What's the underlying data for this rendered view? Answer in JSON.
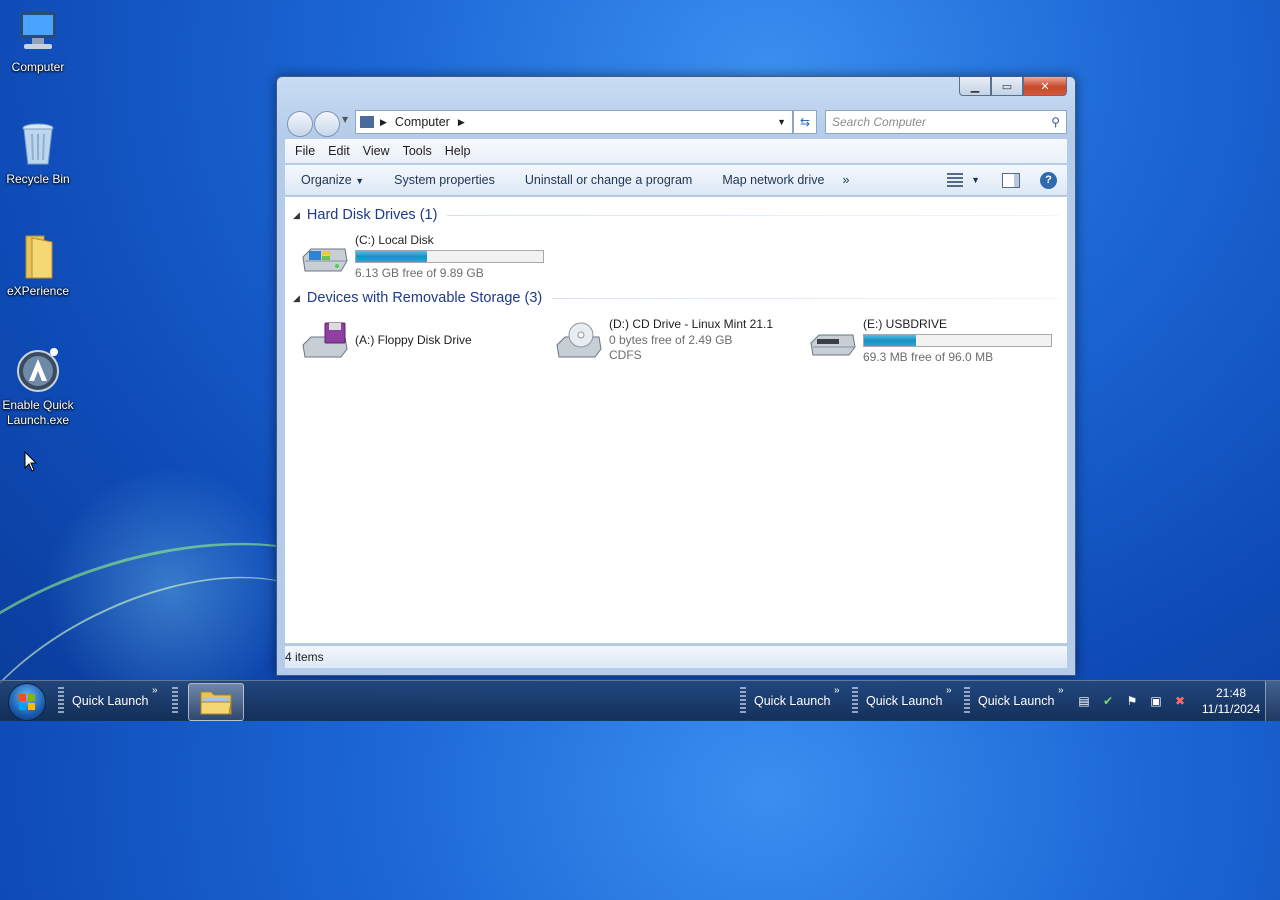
{
  "desktop": {
    "icons": [
      {
        "label": "Computer",
        "icon": "computer-icon"
      },
      {
        "label": "Recycle Bin",
        "icon": "recycle-bin-icon"
      },
      {
        "label": "eXPerience",
        "icon": "folder-icon"
      },
      {
        "label": "Enable Quick Launch.exe",
        "icon": "app-icon"
      }
    ]
  },
  "window": {
    "address": {
      "path": "Computer"
    },
    "search": {
      "placeholder": "Search Computer"
    },
    "menu": [
      "File",
      "Edit",
      "View",
      "Tools",
      "Help"
    ],
    "toolbar": {
      "organize": "Organize",
      "system_properties": "System properties",
      "uninstall": "Uninstall or change a program",
      "map_drive": "Map network drive",
      "more": "»"
    },
    "groups": [
      {
        "title": "Hard Disk Drives (1)",
        "items": [
          {
            "name": "(C:) Local Disk",
            "free_text": "6.13 GB free of 9.89 GB",
            "used_fraction": 0.38,
            "icon": "hard-disk-icon"
          }
        ]
      },
      {
        "title": "Devices with Removable Storage (3)",
        "items": [
          {
            "name": "(A:) Floppy Disk Drive",
            "icon": "floppy-drive-icon"
          },
          {
            "name": "(D:) CD Drive - Linux Mint 21.1",
            "free_text": "0 bytes free of 2.49 GB",
            "fs": "CDFS",
            "icon": "cd-drive-icon"
          },
          {
            "name": "(E:) USBDRIVE",
            "free_text": "69.3 MB free of 96.0 MB",
            "used_fraction": 0.28,
            "icon": "usb-drive-icon"
          }
        ]
      }
    ],
    "status": "4 items"
  },
  "taskbar": {
    "quick_launch_label": "Quick Launch",
    "clock": {
      "time": "21:48",
      "date": "11/11/2024"
    }
  }
}
